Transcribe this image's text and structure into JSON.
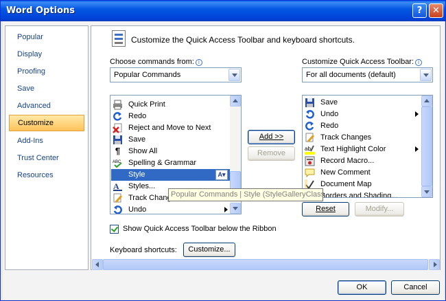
{
  "window": {
    "title": "Word Options",
    "help_glyph": "?",
    "close_glyph": "✕"
  },
  "nav": {
    "items": [
      {
        "label": "Popular"
      },
      {
        "label": "Display"
      },
      {
        "label": "Proofing"
      },
      {
        "label": "Save"
      },
      {
        "label": "Advanced"
      },
      {
        "label": "Customize",
        "selected": true
      },
      {
        "label": "Add-Ins"
      },
      {
        "label": "Trust Center"
      },
      {
        "label": "Resources"
      }
    ]
  },
  "header": {
    "text": "Customize the Quick Access Toolbar and keyboard shortcuts."
  },
  "choose": {
    "label": "Choose commands from:",
    "value": "Popular Commands"
  },
  "customize_qat": {
    "label": "Customize Quick Access Toolbar:",
    "value": "For all documents (default)"
  },
  "commands": [
    {
      "label": "Quick Print",
      "icon": "quick-print-icon"
    },
    {
      "label": "Redo",
      "icon": "redo-icon"
    },
    {
      "label": "Reject and Move to Next",
      "icon": "reject-icon"
    },
    {
      "label": "Save",
      "icon": "save-icon"
    },
    {
      "label": "Show All",
      "icon": "pilcrow-icon"
    },
    {
      "label": "Spelling & Grammar",
      "icon": "spelling-icon"
    },
    {
      "label": "Style",
      "icon": "none",
      "selected": true
    },
    {
      "label": "Styles...",
      "icon": "styles-icon"
    },
    {
      "label": "Track Changes",
      "icon": "track-changes-icon"
    },
    {
      "label": "Undo",
      "icon": "undo-icon",
      "submenu": true
    }
  ],
  "qat_items": [
    {
      "label": "Save",
      "icon": "save-icon"
    },
    {
      "label": "Undo",
      "icon": "undo-icon",
      "submenu": true
    },
    {
      "label": "Redo",
      "icon": "redo-icon"
    },
    {
      "label": "Track Changes",
      "icon": "track-changes-icon"
    },
    {
      "label": "Text Highlight Color",
      "icon": "highlight-icon",
      "submenu": true
    },
    {
      "label": "Record Macro...",
      "icon": "record-macro-icon"
    },
    {
      "label": "New Comment",
      "icon": "new-comment-icon"
    },
    {
      "label": "Document Map",
      "icon": "document-map-icon"
    },
    {
      "label": "Borders and Shading...",
      "icon": "borders-icon"
    }
  ],
  "buttons": {
    "add": "Add >>",
    "remove": "Remove",
    "reset": "Reset",
    "modify": "Modify...",
    "customize": "Customize...",
    "ok": "OK",
    "cancel": "Cancel"
  },
  "tooltip": "Popular Commands | Style (StyleGalleryClassic)",
  "checkbox": {
    "label": "Show Quick Access Toolbar below the Ribbon",
    "checked": true
  },
  "keyboard": {
    "label": "Keyboard shortcuts:"
  }
}
